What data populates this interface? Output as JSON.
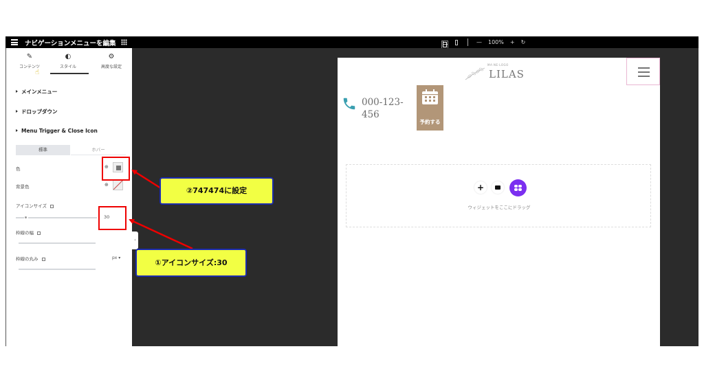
{
  "topbar": {
    "title": "ナビゲーションメニューを編集",
    "zoom": "100%",
    "zoom_minus": "—",
    "zoom_plus": "+",
    "undo_icon": "undo-icon"
  },
  "panel": {
    "tabs": [
      {
        "label": "コンテンツ",
        "icon": "pencil-icon"
      },
      {
        "label": "スタイル",
        "icon": "half-circle-icon"
      },
      {
        "label": "高度な設定",
        "icon": "gear-icon"
      }
    ],
    "sections": [
      {
        "label": "メインメニュー"
      },
      {
        "label": "ドロップダウン"
      },
      {
        "label": "Menu Trigger & Close Icon"
      }
    ],
    "state_tabs": {
      "normal": "標準",
      "hover": "ホバー"
    },
    "fields": {
      "color_label": "色",
      "bg_color_label": "背景色",
      "icon_size_label": "アイコンサイズ",
      "icon_size_value": "30",
      "border_width_label": "枠線の幅",
      "border_radius_label": "枠線の丸み",
      "border_radius_unit": "px"
    },
    "colors": {
      "swatch": "#747474"
    }
  },
  "preview": {
    "logo_small": "MA·NE·LOGO",
    "logo": "LILAS",
    "phone": "000-123-456",
    "book_label": "予約する",
    "book_color": "#b29678",
    "drop_text": "ウィジェットをここにドラッグ",
    "plus": "+"
  },
  "annotations": {
    "callout_color": "②747474に設定",
    "callout_size": "①アイコンサイズ:30"
  }
}
